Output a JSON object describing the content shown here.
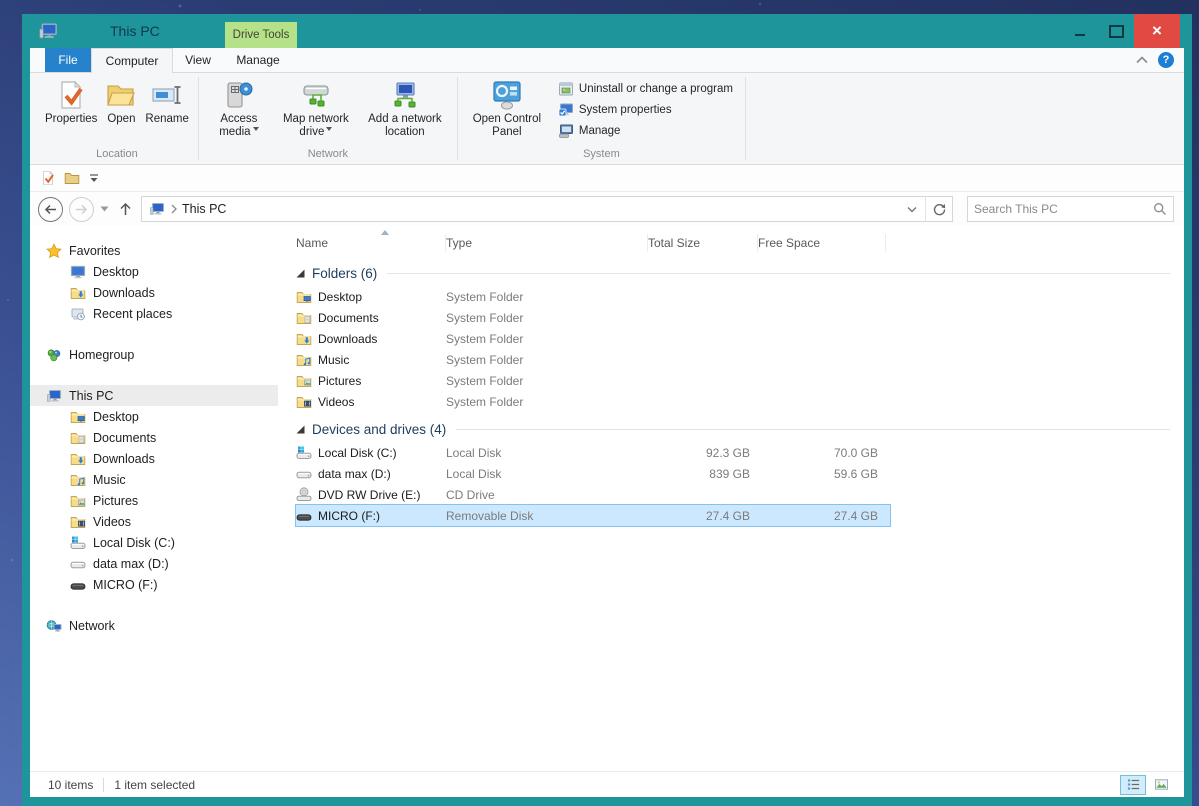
{
  "window": {
    "title": "This PC",
    "contextual_tab": "Drive Tools",
    "controls": {
      "minimize": "minimize",
      "maximize": "maximize",
      "close": "close"
    }
  },
  "colors": {
    "titlebar_teal": "#1e959b",
    "contextual_tab_green": "#b5e189",
    "file_tab_blue": "#2582cb",
    "close_button_red": "#e14a42",
    "selection_bg": "#cce8ff",
    "selection_border": "#84c3f0",
    "group_header_text": "#1e3c5c"
  },
  "tabs": [
    {
      "label": "File"
    },
    {
      "label": "Computer",
      "selected": true
    },
    {
      "label": "View"
    },
    {
      "label": "Manage"
    }
  ],
  "ribbon": {
    "groups": [
      {
        "label": "Location",
        "buttons": [
          {
            "label": "Properties",
            "icon": "properties"
          },
          {
            "label": "Open",
            "icon": "open-folder"
          },
          {
            "label": "Rename",
            "icon": "rename"
          }
        ]
      },
      {
        "label": "Network",
        "buttons": [
          {
            "label": "Access media",
            "icon": "access-media",
            "dropdown": true
          },
          {
            "label": "Map network drive",
            "icon": "map-network-drive",
            "dropdown": true
          },
          {
            "label": "Add a network location",
            "icon": "add-network-location"
          }
        ]
      },
      {
        "label": "System",
        "big": [
          {
            "label": "Open Control Panel",
            "icon": "control-panel"
          }
        ],
        "small": [
          {
            "label": "Uninstall or change a program",
            "icon": "uninstall"
          },
          {
            "label": "System properties",
            "icon": "system-properties"
          },
          {
            "label": "Manage",
            "icon": "manage-small"
          }
        ]
      }
    ]
  },
  "navbar": {
    "address_root": "This PC",
    "search_placeholder": "Search This PC"
  },
  "sidebar": {
    "sections": [
      {
        "root": {
          "label": "Favorites",
          "icon": "star"
        },
        "children": [
          {
            "label": "Desktop",
            "icon": "monitor"
          },
          {
            "label": "Downloads",
            "icon": "folder-down"
          },
          {
            "label": "Recent places",
            "icon": "recent"
          }
        ]
      },
      {
        "root": {
          "label": "Homegroup",
          "icon": "homegroup"
        },
        "children": []
      },
      {
        "root": {
          "label": "This PC",
          "icon": "pc",
          "selected": true
        },
        "children": [
          {
            "label": "Desktop",
            "icon": "folder-desktop"
          },
          {
            "label": "Documents",
            "icon": "folder-docs"
          },
          {
            "label": "Downloads",
            "icon": "folder-down"
          },
          {
            "label": "Music",
            "icon": "folder-music"
          },
          {
            "label": "Pictures",
            "icon": "folder-pics"
          },
          {
            "label": "Videos",
            "icon": "folder-videos"
          },
          {
            "label": "Local Disk (C:)",
            "icon": "drive-c"
          },
          {
            "label": "data max (D:)",
            "icon": "drive"
          },
          {
            "label": "MICRO (F:)",
            "icon": "usb-drive"
          }
        ]
      },
      {
        "root": {
          "label": "Network",
          "icon": "network"
        },
        "children": []
      }
    ]
  },
  "filelist": {
    "columns": [
      "Name",
      "Type",
      "Total Size",
      "Free Space"
    ],
    "sort_column": "Name",
    "groups": [
      {
        "label": "Folders (6)",
        "rows": [
          {
            "name": "Desktop",
            "icon": "folder-desktop",
            "type": "System Folder",
            "total": "",
            "free": ""
          },
          {
            "name": "Documents",
            "icon": "folder-docs",
            "type": "System Folder",
            "total": "",
            "free": ""
          },
          {
            "name": "Downloads",
            "icon": "folder-down",
            "type": "System Folder",
            "total": "",
            "free": ""
          },
          {
            "name": "Music",
            "icon": "folder-music",
            "type": "System Folder",
            "total": "",
            "free": ""
          },
          {
            "name": "Pictures",
            "icon": "folder-pics",
            "type": "System Folder",
            "total": "",
            "free": ""
          },
          {
            "name": "Videos",
            "icon": "folder-videos",
            "type": "System Folder",
            "total": "",
            "free": ""
          }
        ]
      },
      {
        "label": "Devices and drives (4)",
        "rows": [
          {
            "name": "Local Disk (C:)",
            "icon": "drive-c",
            "type": "Local Disk",
            "total": "92.3 GB",
            "free": "70.0 GB"
          },
          {
            "name": "data max (D:)",
            "icon": "drive",
            "type": "Local Disk",
            "total": "839 GB",
            "free": "59.6 GB"
          },
          {
            "name": "DVD RW Drive (E:)",
            "icon": "dvd-drive",
            "type": "CD Drive",
            "total": "",
            "free": ""
          },
          {
            "name": "MICRO (F:)",
            "icon": "usb-drive",
            "type": "Removable Disk",
            "total": "27.4 GB",
            "free": "27.4 GB",
            "selected": true
          }
        ]
      }
    ]
  },
  "statusbar": {
    "items_count": "10 items",
    "selected_count": "1 item selected"
  }
}
